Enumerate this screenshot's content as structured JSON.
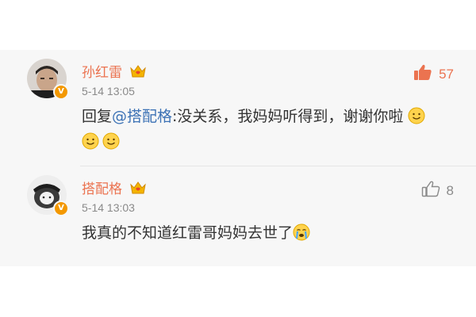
{
  "comments": [
    {
      "author": "孙红雷",
      "time": "5-14 13:05",
      "reply_prefix": "回复",
      "mention": "@搭配格",
      "text": ":没关系，我妈妈听得到，谢谢你啦",
      "emojis": [
        "smile-emoji",
        "smile-emoji",
        "smile-emoji"
      ],
      "likes": "57",
      "liked": true
    },
    {
      "author": "搭配格",
      "time": "5-14 13:03",
      "text": "我真的不知道红雷哥妈妈去世了",
      "emojis": [
        "crying-emoji"
      ],
      "likes": "8",
      "liked": false
    }
  ],
  "colors": {
    "name": "#eb7350",
    "mention": "#3c72b5",
    "liked": "#eb7350",
    "unliked": "#8a8a8a",
    "verified_badge": "#f39800"
  }
}
